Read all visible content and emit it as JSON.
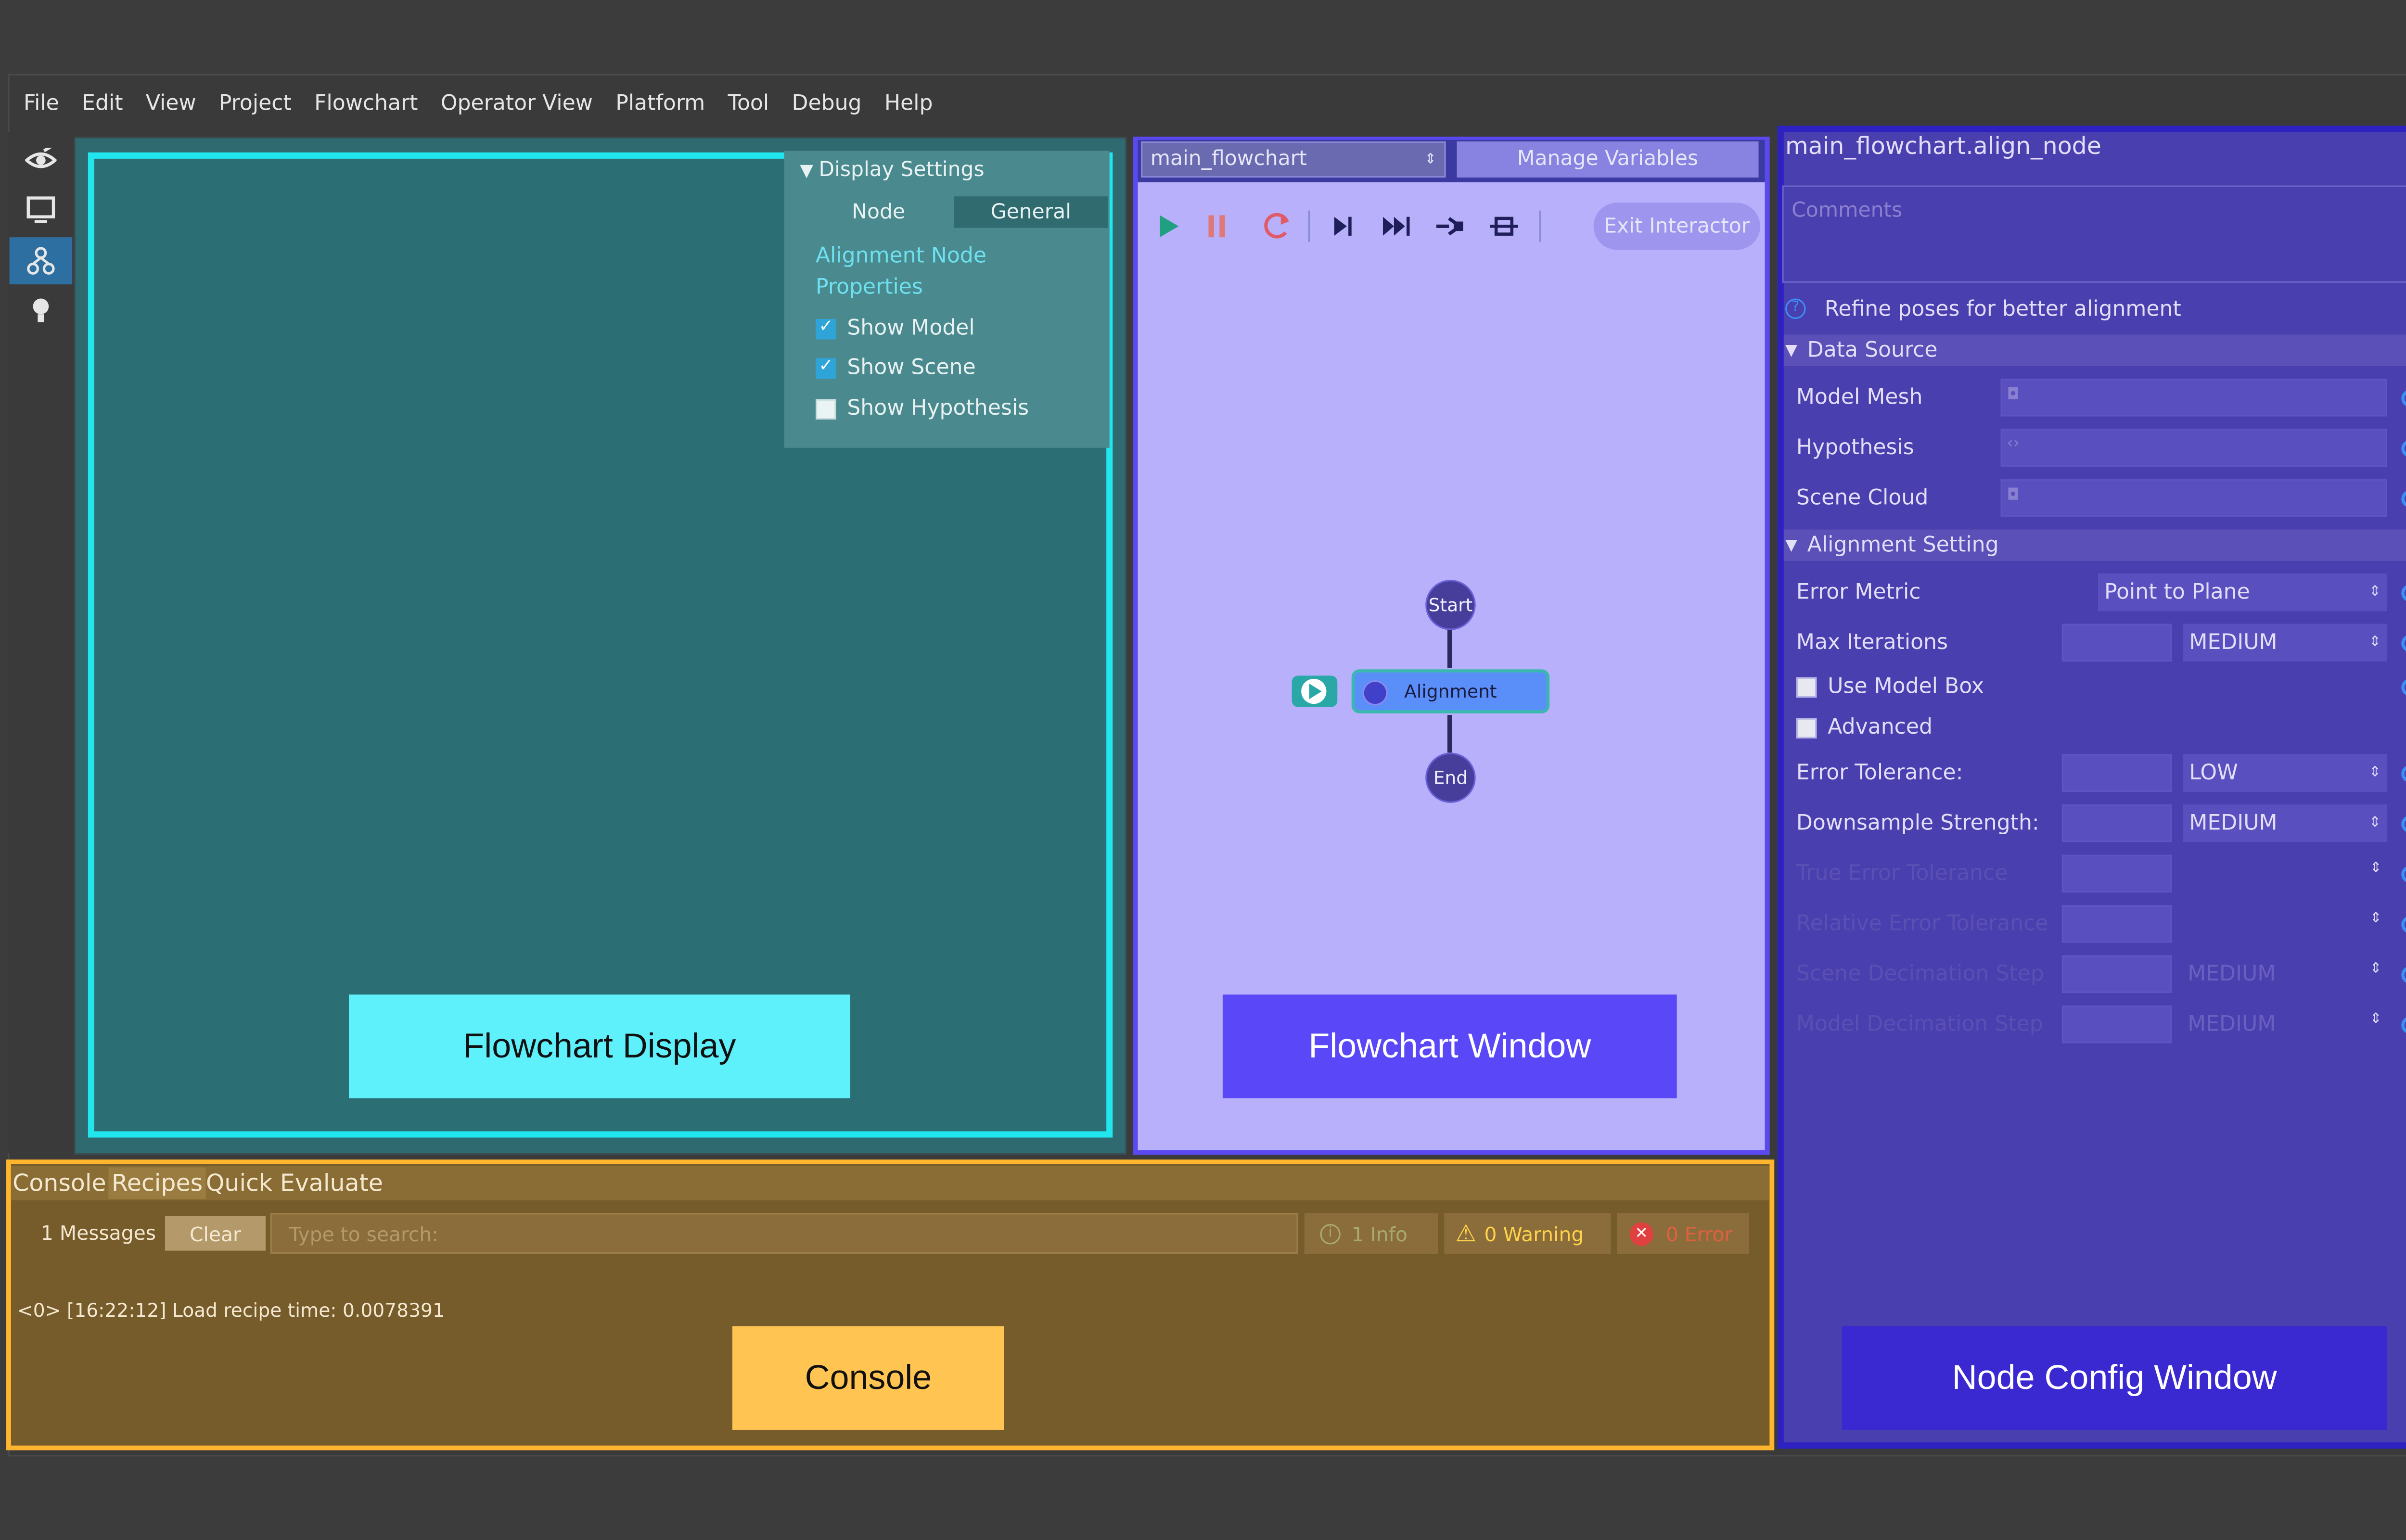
{
  "menu": [
    "File",
    "Edit",
    "View",
    "Project",
    "Flowchart",
    "Operator View",
    "Platform",
    "Tool",
    "Debug",
    "Help"
  ],
  "toolbar": {
    "icons": [
      "eye-icon",
      "monitor-icon",
      "flowchart-icon",
      "bulb-icon"
    ],
    "active_index": 2
  },
  "display_settings": {
    "header": "Display Settings",
    "tabs": [
      "Node",
      "General"
    ],
    "active_tab": "General",
    "properties_label": "Alignment Node Properties",
    "options": [
      {
        "label": "Show Model",
        "checked": true
      },
      {
        "label": "Show Scene",
        "checked": true
      },
      {
        "label": "Show Hypothesis",
        "checked": false
      }
    ]
  },
  "flowchart_window": {
    "selected_flowchart": "main_flowchart",
    "manage_variables": "Manage Variables",
    "exit_interactor": "Exit Interactor",
    "nodes": {
      "start": "Start",
      "alignment": "Alignment",
      "end": "End"
    }
  },
  "node_config": {
    "title": "main_flowchart.align_node",
    "comments_placeholder": "Comments",
    "description": "Refine poses for better alignment",
    "data_source": {
      "header": "Data Source",
      "rows": [
        "Model Mesh",
        "Hypothesis",
        "Scene Cloud"
      ]
    },
    "alignment_setting": {
      "header": "Alignment Setting",
      "error_metric": {
        "label": "Error Metric",
        "value": "Point to Plane"
      },
      "max_iterations": {
        "label": "Max Iterations",
        "value": "MEDIUM"
      },
      "use_model_box": {
        "label": "Use Model Box",
        "checked": false
      },
      "advanced": {
        "label": "Advanced",
        "checked": false
      },
      "error_tolerance": {
        "label": "Error Tolerance:",
        "value": "LOW"
      },
      "downsample_strength": {
        "label": "Downsample Strength:",
        "value": "MEDIUM"
      },
      "true_error_tolerance": {
        "label": "True Error Tolerance",
        "value": ""
      },
      "relative_error_tolerance": {
        "label": "Relative Error Tolerance",
        "value": ""
      },
      "scene_decimation_step": {
        "label": "Scene Decimation Step",
        "value": "MEDIUM"
      },
      "model_decimation_step": {
        "label": "Model Decimation Step",
        "value": "MEDIUM"
      }
    }
  },
  "console": {
    "tabs": [
      "Console",
      "Recipes",
      "Quick Evaluate"
    ],
    "message_count": "1 Messages",
    "clear": "Clear",
    "search_placeholder": "Type to search:",
    "info": "1 Info",
    "warning": "0 Warning",
    "error": "0 Error",
    "log": "<0> [16:22:12] Load recipe time: 0.0078391"
  },
  "overlay_labels": {
    "flowchart_display": "Flowchart Display",
    "flowchart_window": "Flowchart Window",
    "console": "Console",
    "node_config_window": "Node Config Window"
  },
  "colors": {
    "flowchart_display": "#22e6ee",
    "flowchart_window": "#5a48f0",
    "console": "#ffb52e",
    "node_config": "#2d21c0"
  }
}
